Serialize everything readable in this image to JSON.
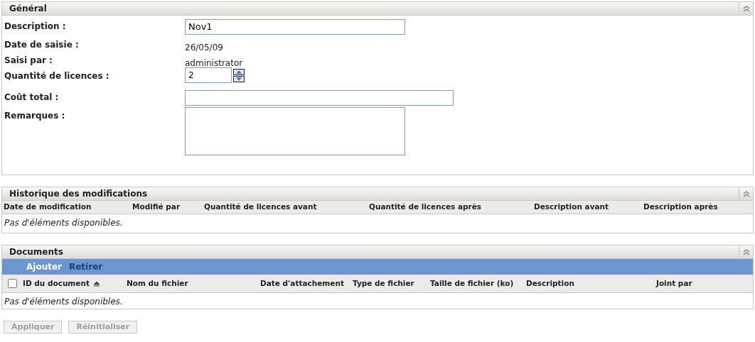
{
  "general": {
    "title": "Général",
    "fields": [
      {
        "kind": "input",
        "label": "Description :",
        "value": "Nov1"
      },
      {
        "kind": "text",
        "label": "Date de saisie :",
        "value": "26/05/09"
      },
      {
        "kind": "text",
        "label": "Saisi par :",
        "value": "administrator"
      },
      {
        "kind": "spinner",
        "label": "Quantité de licences :",
        "value": "2"
      },
      {
        "kind": "wide_input",
        "label": "Coût total :"
      },
      {
        "kind": "textarea",
        "label": "Remarques :"
      }
    ]
  },
  "history": {
    "title": "Historique des modifications",
    "columns": [
      "Date de modification",
      "Modifié par",
      "Quantité de licences avant",
      "Quantité de licences après",
      "Description avant",
      "Description après"
    ],
    "empty": "Pas d'éléments disponibles."
  },
  "documents": {
    "title": "Documents",
    "actions": [
      "Ajouter",
      "Retirer"
    ],
    "select_all": {
      "checked": false
    },
    "columns": [
      "ID du document",
      "Nom du fichier",
      "Date d'attachement",
      "Type de fichier",
      "Taille de fichier (ko)",
      "Description",
      "Joint par"
    ],
    "empty": "Pas d'éléments disponibles."
  },
  "buttons": [
    {
      "label": "Appliquer",
      "disabled": true
    },
    {
      "label": "Réinitialiser",
      "disabled": true
    }
  ]
}
